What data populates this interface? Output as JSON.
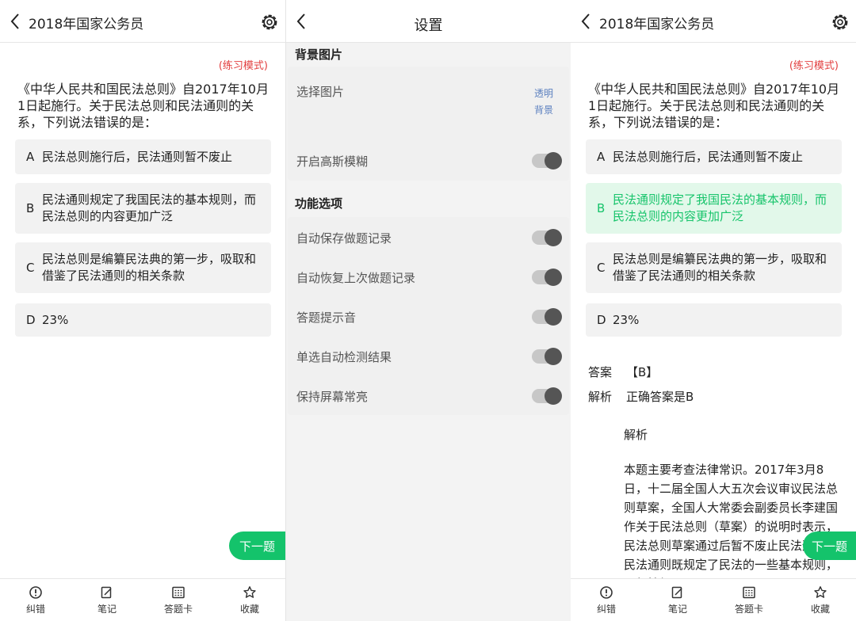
{
  "left": {
    "header_title": "2018年国家公务员",
    "mode": "(练习模式)",
    "question": "《中华人民共和国民法总则》自2017年10月1日起施行。关于民法总则和民法通则的关系，下列说法错误的是：",
    "options": [
      {
        "label": "A",
        "text": "民法总则施行后，民法通则暂不废止"
      },
      {
        "label": "B",
        "text": "民法通则规定了我国民法的基本规则，而民法总则的内容更加广泛"
      },
      {
        "label": "C",
        "text": "民法总则是编纂民法典的第一步，吸取和借鉴了民法通则的相关条款"
      },
      {
        "label": "D",
        "text": "23%"
      }
    ],
    "next_label": "下一题"
  },
  "settings": {
    "title": "设置",
    "bg_section": "背景图片",
    "choose_image": "选择图片",
    "transparent_bg": "透明背景",
    "gaussian_blur": "开启高斯模糊",
    "func_section": "功能选项",
    "toggles": [
      {
        "label": "自动保存做题记录",
        "on": true
      },
      {
        "label": "自动恢复上次做题记录",
        "on": true
      },
      {
        "label": "答题提示音",
        "on": true
      },
      {
        "label": "单选自动检测结果",
        "on": true
      },
      {
        "label": "保持屏幕常亮",
        "on": true
      }
    ]
  },
  "right": {
    "header_title": "2018年国家公务员",
    "mode": "(练习模式)",
    "question": "《中华人民共和国民法总则》自2017年10月1日起施行。关于民法总则和民法通则的关系，下列说法错误的是：",
    "options": [
      {
        "label": "A",
        "text": "民法总则施行后，民法通则暂不废止"
      },
      {
        "label": "B",
        "text": "民法通则规定了我国民法的基本规则，而民法总则的内容更加广泛"
      },
      {
        "label": "C",
        "text": "民法总则是编纂民法典的第一步，吸取和借鉴了民法通则的相关条款"
      },
      {
        "label": "D",
        "text": "23%"
      }
    ],
    "answer_label": "答案",
    "answer_value": "【B】",
    "analysis_label": "解析",
    "analysis_first": "正确答案是B",
    "analysis_heading": "解析",
    "analysis_body": "本题主要考查法律常识。2017年3月8日，十二届全国人大五次会议审议民法总则草案，全国人大常委会副委员长李建国作关于民法总则（草案）的说明时表示，民法总则草案通过后暂不废止民法通则。民法通则既规定了民法的一些基本规则，一般性规",
    "next_label": "下一题"
  },
  "tabbar": {
    "items": [
      {
        "icon": "error-correct-icon",
        "label": "纠错"
      },
      {
        "icon": "note-icon",
        "label": "笔记"
      },
      {
        "icon": "answer-card-icon",
        "label": "答题卡"
      },
      {
        "icon": "star-icon",
        "label": "收藏"
      }
    ]
  },
  "colors": {
    "accent_green": "#14c36b",
    "correct_bg": "#e2f8ea",
    "mode_red": "#e23f3f",
    "link_blue": "#5a7fbf"
  }
}
